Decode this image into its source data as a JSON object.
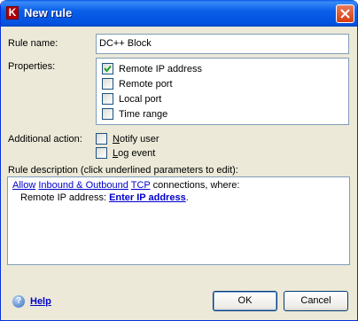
{
  "window": {
    "title": "New rule"
  },
  "form": {
    "rule_name_label": "Rule name:",
    "rule_name_value": "DC++ Block",
    "properties_label": "Properties:",
    "properties": [
      {
        "label": "Remote IP address",
        "checked": true
      },
      {
        "label": "Remote port",
        "checked": false
      },
      {
        "label": "Local port",
        "checked": false
      },
      {
        "label": "Time range",
        "checked": false
      }
    ],
    "additional_action_label": "Additional action:",
    "actions": [
      {
        "label": "Notify user",
        "checked": false,
        "accel": "N",
        "rest": "otify user"
      },
      {
        "label": "Log event",
        "checked": false,
        "accel": "L",
        "rest": "og event"
      }
    ]
  },
  "description": {
    "label": "Rule description (click underlined parameters to edit):",
    "line1": {
      "allow": "Allow",
      "direction": "Inbound & Outbound",
      "protocol": "TCP",
      "rest": "connections, where:"
    },
    "line2": {
      "prefix": "Remote IP address:",
      "value": "Enter IP address",
      "suffix": "."
    }
  },
  "footer": {
    "help_label": "Help",
    "ok_label": "OK",
    "cancel_label": "Cancel"
  },
  "colors": {
    "titlebar": "#0A5FE8",
    "dialog_bg": "#ECE9D8",
    "link": "#0000CC",
    "close": "#D43C10"
  }
}
